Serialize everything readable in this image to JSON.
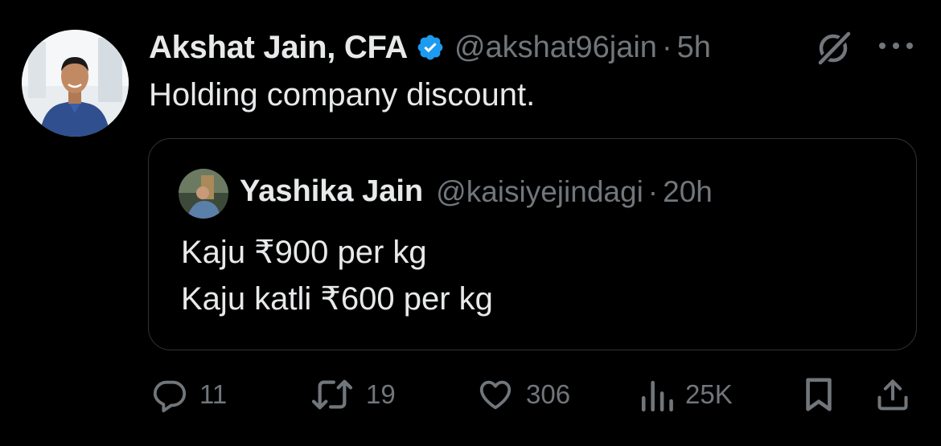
{
  "tweet": {
    "author_name": "Akshat Jain, CFA",
    "handle": "@akshat96jain",
    "separator": "·",
    "time": "5h",
    "text": "Holding company discount."
  },
  "quoted": {
    "author_name": "Yashika Jain",
    "handle": "@kaisiyejindagi",
    "separator": "·",
    "time": "20h",
    "lines": [
      "Kaju ₹900 per kg",
      "Kaju katli ₹600 per kg"
    ]
  },
  "actions": {
    "replies": "11",
    "reposts": "19",
    "likes": "306",
    "views": "25K"
  },
  "icons": {
    "verified": "verified-badge-icon",
    "grok": "grok-icon",
    "more": "more-icon",
    "reply": "reply-icon",
    "repost": "repost-icon",
    "like": "heart-icon",
    "views": "views-icon",
    "bookmark": "bookmark-icon",
    "share": "share-icon"
  },
  "colors": {
    "background": "#000000",
    "text": "#e7e9ea",
    "secondary": "#71767b",
    "verified": "#1d9bf0",
    "border": "#2f3336"
  }
}
